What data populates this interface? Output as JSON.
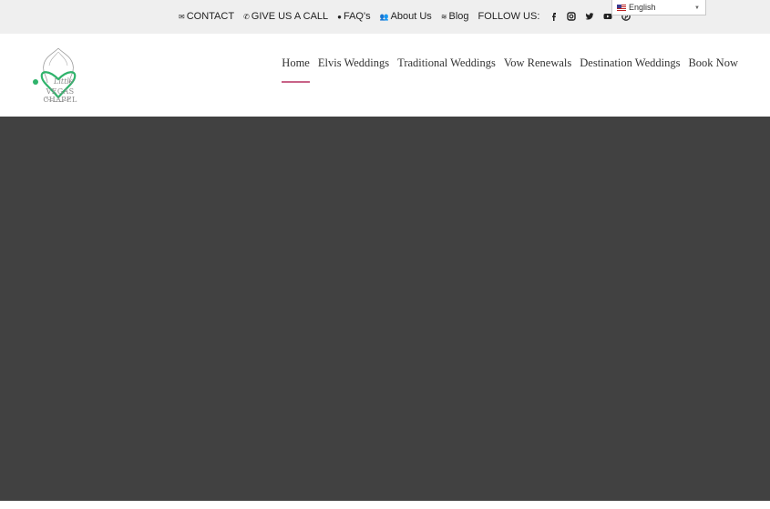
{
  "topbar": {
    "links": [
      {
        "icon": "envelope-icon",
        "label": "CONTACT"
      },
      {
        "icon": "phone-icon",
        "label": "GIVE US A CALL"
      },
      {
        "icon": "question-icon",
        "label": "FAQ's"
      },
      {
        "icon": "users-icon",
        "label": "About Us"
      },
      {
        "icon": "rss-icon",
        "label": "Blog"
      }
    ],
    "follow_label": "FOLLOW US:",
    "social": [
      "facebook-icon",
      "instagram-icon",
      "twitter-icon",
      "youtube-icon",
      "pinterest-icon"
    ],
    "language": "English"
  },
  "logo": {
    "text": "VEGAS CHAPEL",
    "script": "Little"
  },
  "nav": {
    "items": [
      "Home",
      "Elvis Weddings",
      "Traditional Weddings",
      "Vow Renewals",
      "Destination Weddings",
      "Book Now"
    ],
    "active": "Home"
  },
  "colors": {
    "accent": "#c86287",
    "hero_bg": "#414141",
    "topbar_bg": "#efefef",
    "logo_green": "#2fb36b"
  }
}
